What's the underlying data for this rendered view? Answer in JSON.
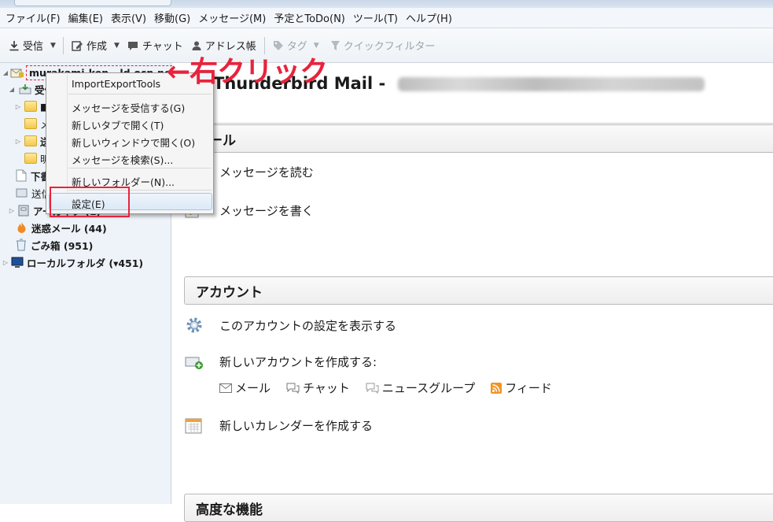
{
  "menubar": [
    "ファイル(F)",
    "編集(E)",
    "表示(V)",
    "移動(G)",
    "メッセージ(M)",
    "予定とToDo(N)",
    "ツール(T)",
    "ヘルプ(H)"
  ],
  "toolbar": {
    "receive": "受信",
    "compose": "作成",
    "chat": "チャット",
    "address_book": "アドレス帳",
    "tag": "タグ",
    "quick_filter": "クイックフィルター"
  },
  "sidebar": {
    "account": "murakami-ken...ld.ocn.ne.jp",
    "inbox": "受信",
    "folder1": "■",
    "folder2": "メ",
    "folder3": "送",
    "folder4": "明",
    "drafts": "下書",
    "sent": "送信",
    "archive": "アーカイブ (1)",
    "junk": "迷惑メール (44)",
    "trash": "ごみ箱 (951)",
    "local": "ローカルフォルダ (▾451)"
  },
  "context_menu": {
    "item0": "ImportExportTools",
    "item1": "メッセージを受信する(G)",
    "item2": "新しいタブで開く(T)",
    "item3": "新しいウィンドウで開く(O)",
    "item4": "メッセージを検索(S)...",
    "item5": "新しいフォルダー(N)...",
    "item6": "設定(E)"
  },
  "annotation": "←右クリック",
  "main": {
    "title": "Thunderbird Mail -",
    "mail_section": "メール",
    "read_messages": "メッセージを読む",
    "write_message": "メッセージを書く",
    "account_section": "アカウント",
    "view_settings": "このアカウントの設定を表示する",
    "create_account": "新しいアカウントを作成する:",
    "link_mail": "メール",
    "link_chat": "チャット",
    "link_newsgroup": "ニュースグループ",
    "link_feed": "フィード",
    "create_calendar": "新しいカレンダーを作成する",
    "advanced_section": "高度な機能"
  },
  "colors": {
    "annotation_red": "#e8233d",
    "sidebar_bg": "#eef3f9"
  }
}
